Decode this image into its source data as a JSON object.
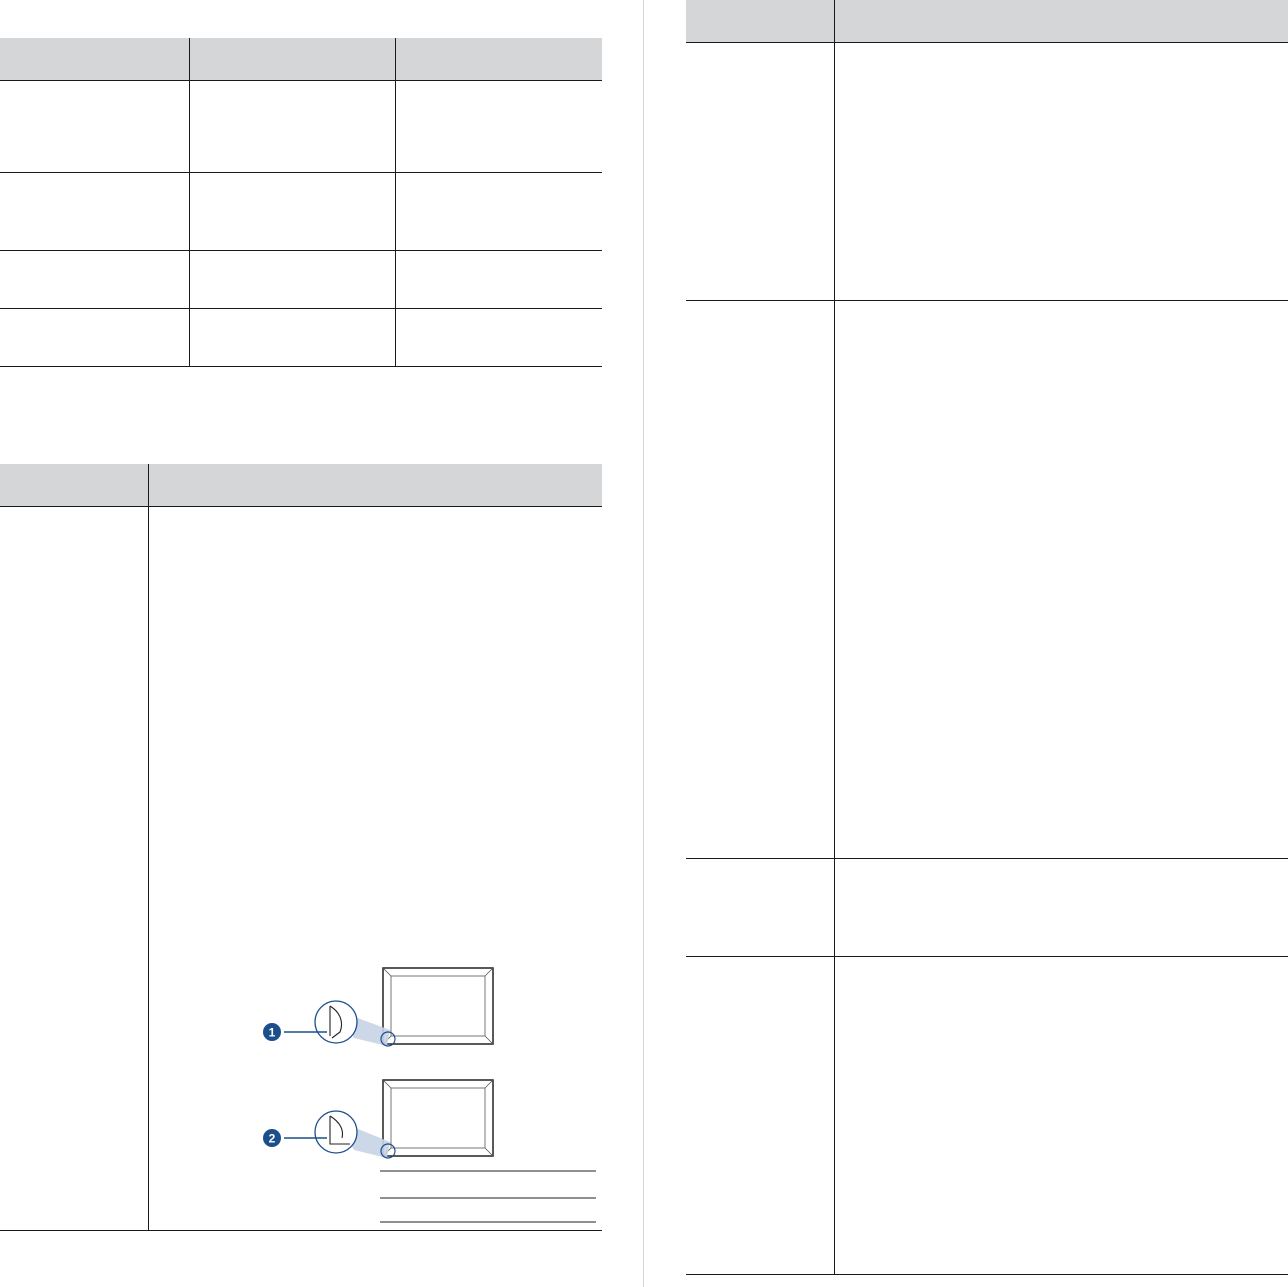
{
  "page": {
    "left_table": {
      "columns": [
        "",
        "",
        ""
      ],
      "rows": [
        [
          "",
          "",
          ""
        ],
        [
          "",
          "",
          ""
        ],
        [
          "",
          "",
          ""
        ],
        [
          "",
          "",
          ""
        ]
      ]
    },
    "left_table_2": {
      "columns": [
        "",
        ""
      ],
      "rows": [
        [
          "",
          ""
        ]
      ]
    },
    "right_table": {
      "columns": [
        "",
        ""
      ],
      "rows": [
        [
          "",
          ""
        ],
        [
          "",
          ""
        ],
        [
          "",
          ""
        ],
        [
          "",
          ""
        ]
      ]
    },
    "figure": {
      "callouts": [
        "1",
        "2"
      ]
    }
  },
  "colors": {
    "header_fill": "#d5d6d8",
    "rule": "#1a1a1a",
    "callout_blue": "#1b4f8c",
    "gutter": "#d6d6d6"
  }
}
